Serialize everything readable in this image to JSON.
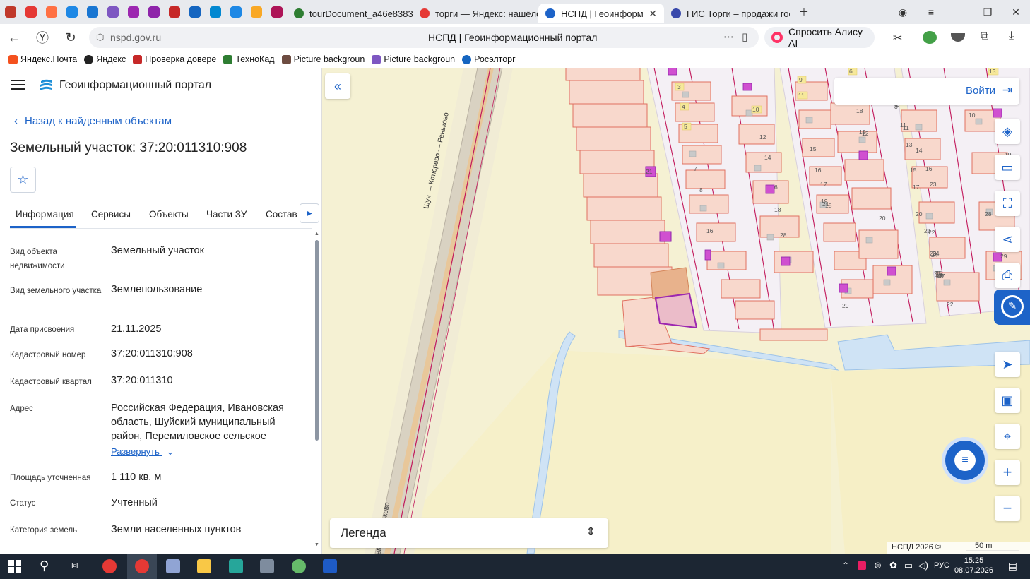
{
  "browser": {
    "tabs": [
      {
        "label": "tourDocument_a46e8383-",
        "active": false
      },
      {
        "label": "торги — Яндекс: нашёлся",
        "active": false
      },
      {
        "label": "НСПД | Геоинформаци",
        "active": true
      },
      {
        "label": "ГИС Торги – продажи гос",
        "active": false
      }
    ],
    "url": "nspd.gov.ru",
    "page_title": "НСПД | Геоинформационный портал",
    "alice_label": "Спросить Алису AI",
    "bookmarks": [
      "Яндекс.Почта",
      "Яндекс",
      "Проверка довере",
      "ТехноКад",
      "Picture backgroun",
      "Picture backgroun",
      "Росэлторг"
    ]
  },
  "panel": {
    "portal_name": "Геоинформационный портал",
    "back_label": "Назад к найденным объектам",
    "title": "Земельный участок: 37:20:011310:908",
    "tabs": [
      "Информация",
      "Сервисы",
      "Объекты",
      "Части ЗУ",
      "Состав"
    ],
    "rows": [
      {
        "label": "Вид объекта недвижимости",
        "value": "Земельный участок"
      },
      {
        "label": "Вид земельного участка",
        "value": "Землепользование"
      },
      {
        "label": "Дата присвоения",
        "value": "21.11.2025"
      },
      {
        "label": "Кадастровый номер",
        "value": "37:20:011310:908"
      },
      {
        "label": "Кадастровый квартал",
        "value": "37:20:011310"
      },
      {
        "label": "Адрес",
        "value": "Российская Федерация, Ивановская область, Шуйский муниципальный район, Перемиловское сельское"
      },
      {
        "label": "Площадь уточненная",
        "value": "1 110 кв. м"
      },
      {
        "label": "Статус",
        "value": "Учтенный"
      },
      {
        "label": "Категория земель",
        "value": "Земли населенных пунктов"
      }
    ],
    "expand_label": "Развернуть"
  },
  "map": {
    "login_label": "Войти",
    "legend_label": "Легенда",
    "attribution": "НСПД 2026 ©",
    "scale_label": "50 m",
    "road_label_top": "Шуя — Котюрево — Реньково",
    "road_label_bottom": "ево — Реньково",
    "parcel_numbers": [
      "6",
      "13",
      "3",
      "9",
      "10",
      "11",
      "4",
      "5",
      "12",
      "18",
      "9",
      "10",
      "11",
      "6",
      "14",
      "7",
      "8",
      "16",
      "18",
      "28",
      "29",
      "20",
      "21",
      "15",
      "16",
      "17",
      "19",
      "21",
      "18",
      "12",
      "13",
      "14",
      "16",
      "23",
      "24",
      "25",
      "26",
      "27",
      "22",
      "19",
      "20",
      "21",
      "22",
      "23",
      "24",
      "25",
      "26",
      "27",
      "28",
      "29",
      "17",
      "15",
      "12",
      "11",
      "9",
      "8"
    ]
  },
  "taskbar": {
    "lang": "РУС",
    "time": "15:25",
    "date": "08.07.2026"
  },
  "colors": {
    "accent": "#1d63c8",
    "parcel_fill": "#f8d8cc",
    "parcel_stroke": "#e07060",
    "boundary": "#c2185b",
    "building": "#d050d0",
    "field": "#f5f1d3",
    "water": "#cfe3f5"
  }
}
